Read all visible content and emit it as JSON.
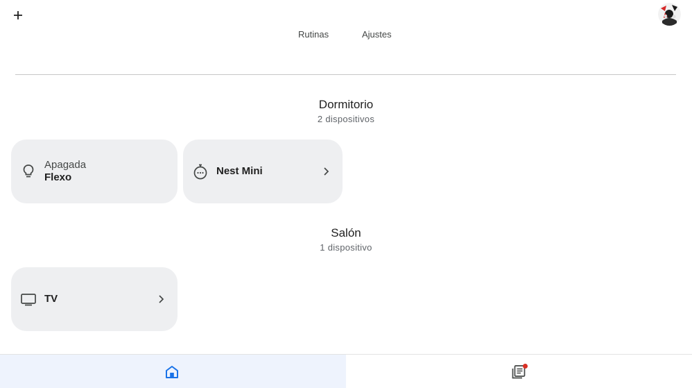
{
  "header": {
    "add_icon": "plus-icon",
    "avatar_icon": "profile-avatar"
  },
  "top_tabs": [
    {
      "label": "Rutinas"
    },
    {
      "label": "Ajustes"
    }
  ],
  "rooms": [
    {
      "name": "Dormitorio",
      "count_label": "2 dispositivos",
      "devices": [
        {
          "status": "Apagada",
          "name": "Flexo",
          "icon": "lightbulb-icon"
        },
        {
          "name": "Nest Mini",
          "icon": "speaker-icon"
        }
      ]
    },
    {
      "name": "Salón",
      "count_label": "1 dispositivo",
      "devices": [
        {
          "name": "TV",
          "icon": "tv-icon"
        }
      ]
    }
  ],
  "bottom_nav": [
    {
      "name": "Home",
      "icon": "home-icon",
      "selected": true
    },
    {
      "name": "Feed",
      "icon": "feed-icon",
      "badge": true
    }
  ],
  "colors": {
    "accent": "#1a73e8",
    "card_bg": "#eeeff1",
    "nav_selected_bg": "#eef3fd",
    "badge": "#d93025"
  }
}
